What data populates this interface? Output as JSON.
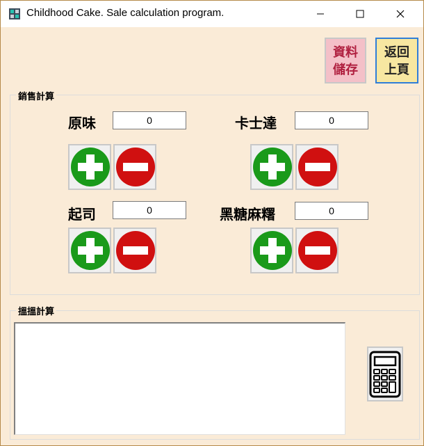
{
  "window": {
    "title": "Childhood Cake. Sale calculation program."
  },
  "toolbar": {
    "save_label_line1": "資料",
    "save_label_line2": "儲存",
    "back_label_line1": "返回",
    "back_label_line2": "上頁"
  },
  "sales": {
    "group_label": "銷售計算",
    "items": [
      {
        "label": "原味",
        "value": "0"
      },
      {
        "label": "卡士達",
        "value": "0"
      },
      {
        "label": "起司",
        "value": "0"
      },
      {
        "label": "黑糖麻糬",
        "value": "0"
      }
    ]
  },
  "calc": {
    "group_label": "搵搵計算",
    "output_text": ""
  },
  "colors": {
    "background": "#faebd7",
    "plus_green": "#1a9a1a",
    "minus_red": "#d01010",
    "save_bg": "#f4c0c8",
    "back_bg": "#f7e7a1",
    "back_border": "#2f7ed8"
  },
  "icons": {
    "app": "app-grid-icon",
    "plus": "plus-circle-icon",
    "minus": "minus-circle-icon",
    "calculator": "calculator-icon"
  }
}
